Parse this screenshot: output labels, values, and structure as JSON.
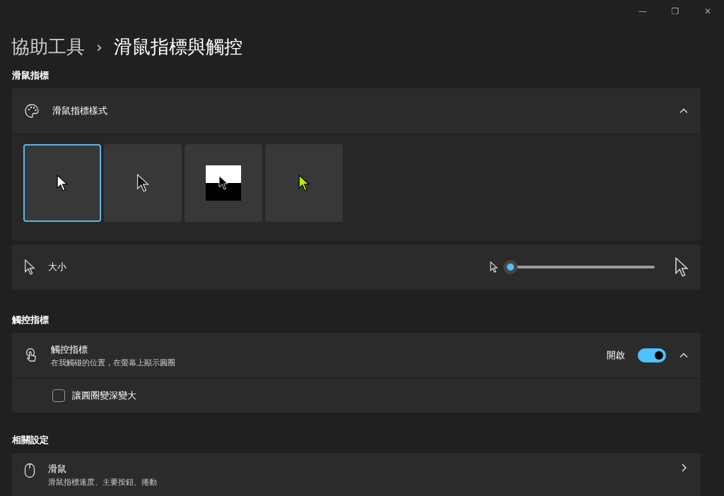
{
  "window": {
    "controls": [
      "—",
      "❐",
      "✕"
    ]
  },
  "breadcrumb": {
    "parent": "協助工具",
    "separator": "›",
    "current": "滑鼠指標與觸控"
  },
  "pointer_section": {
    "heading": "滑鼠指標",
    "style_card": {
      "title": "滑鼠指標樣式",
      "expanded": true,
      "styles": [
        {
          "kind": "white",
          "selected": true
        },
        {
          "kind": "black",
          "selected": false
        },
        {
          "kind": "inverted",
          "selected": false
        },
        {
          "kind": "custom",
          "selected": false,
          "color": "#b4f000"
        }
      ]
    },
    "size": {
      "label": "大小",
      "level": 0.0
    }
  },
  "touch_section": {
    "heading": "觸控指標",
    "title": "觸控指標",
    "subtitle": "在我觸碰的位置，在螢幕上顯示圓圈",
    "state_label": "開啟",
    "on": true,
    "expanded": true,
    "option": {
      "label": "讓圓圈變深變大",
      "checked": false
    }
  },
  "related_section": {
    "heading": "相關設定",
    "items": [
      {
        "title": "滑鼠",
        "subtitle": "滑鼠指標速度、主要按鈕、捲動"
      }
    ]
  }
}
